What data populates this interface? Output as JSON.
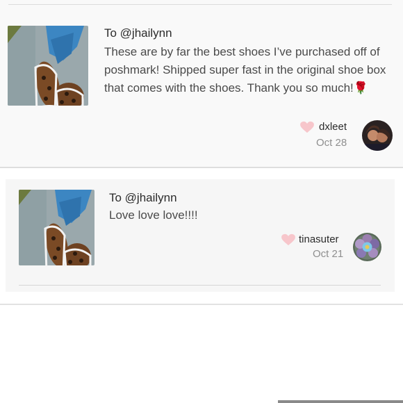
{
  "reviews": [
    {
      "to": "To @jhailynn",
      "message": "These are by far the best shoes I’ve purchased off of poshmark! Shipped super fast in the original shoe box that comes with the shoes. Thank you so much!🌹",
      "username": "dxleet",
      "date": "Oct 28"
    },
    {
      "to": "To @jhailynn",
      "message": "Love love love!!!!",
      "username": "tinasuter",
      "date": "Oct 21"
    }
  ],
  "colors": {
    "heart": "#f7c6cb",
    "text_primary": "#2b2b2b",
    "text_secondary": "#8f8f8f"
  }
}
